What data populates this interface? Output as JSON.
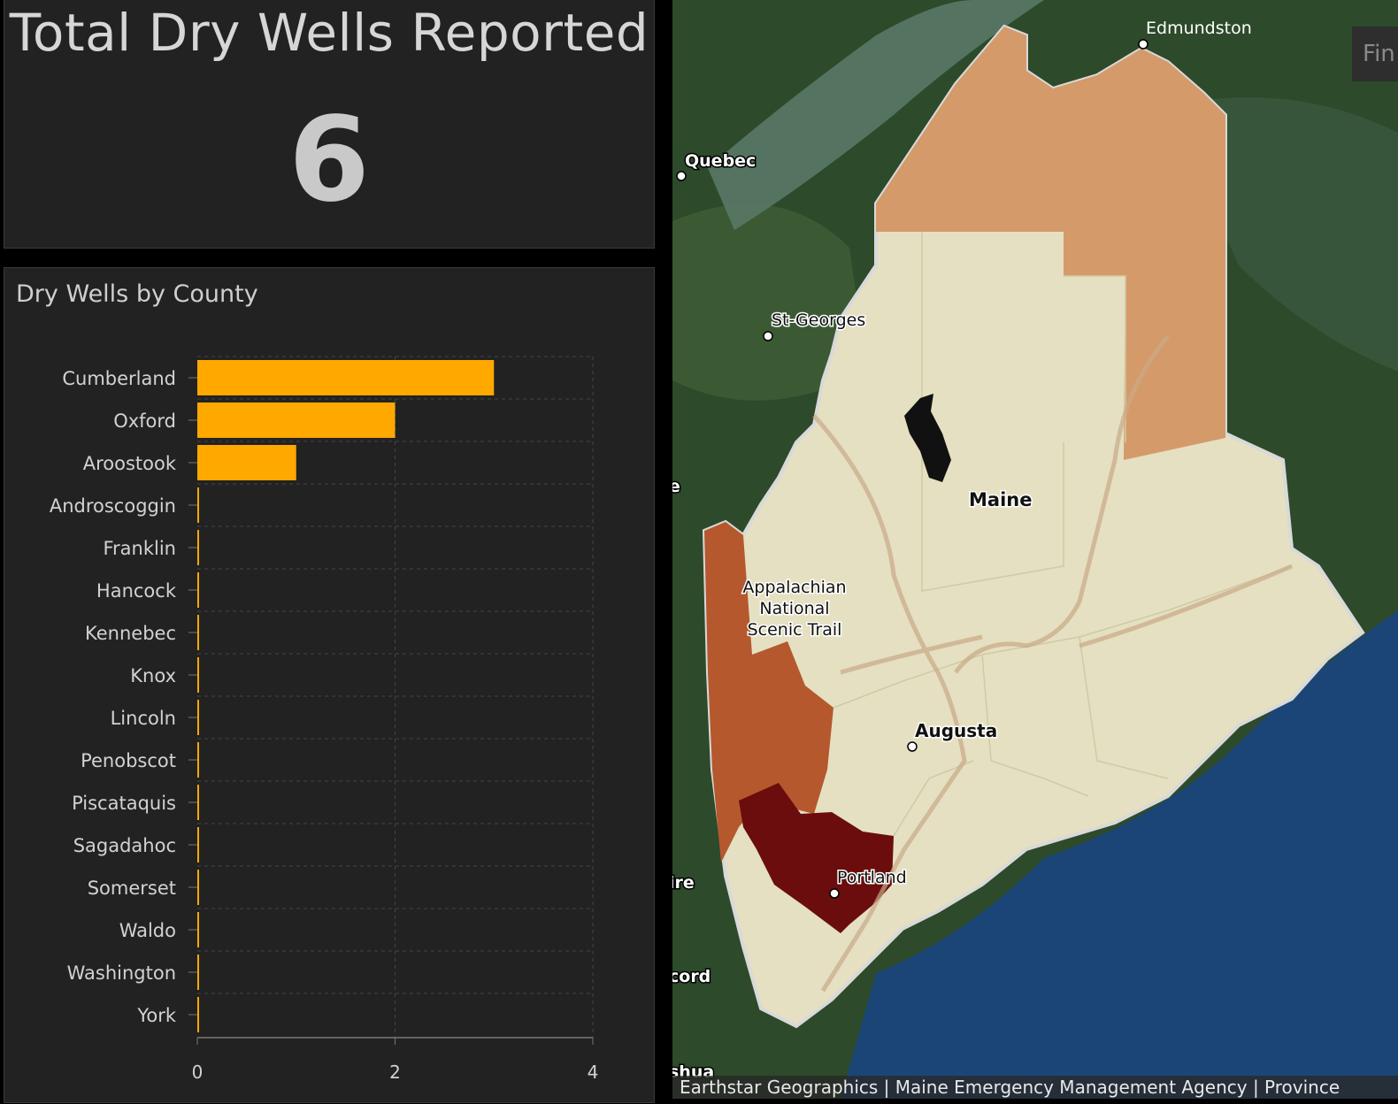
{
  "total": {
    "title": "Total Dry Wells Reported",
    "value": "6"
  },
  "chart_panel": {
    "title": "Dry Wells by County"
  },
  "chart_data": {
    "type": "bar",
    "orientation": "horizontal",
    "title": "Dry Wells by County",
    "categories": [
      "Cumberland",
      "Oxford",
      "Aroostook",
      "Androscoggin",
      "Franklin",
      "Hancock",
      "Kennebec",
      "Knox",
      "Lincoln",
      "Penobscot",
      "Piscataquis",
      "Sagadahoc",
      "Somerset",
      "Waldo",
      "Washington",
      "York"
    ],
    "values": [
      3,
      2,
      1,
      0,
      0,
      0,
      0,
      0,
      0,
      0,
      0,
      0,
      0,
      0,
      0,
      0
    ],
    "xlim": [
      0,
      4
    ],
    "xticks": [
      "0",
      "2",
      "4"
    ],
    "bar_color": "#FFA800",
    "grid": true
  },
  "map": {
    "labels": {
      "edmundston": "Edmundston",
      "quebec": "Quebec",
      "st_georges": "St-Georges",
      "maine": "Maine",
      "trail_line1": "Appalachian",
      "trail_line2": "National",
      "trail_line3": "Scenic Trail",
      "augusta": "Augusta",
      "portland": "Portland",
      "edge_e": "e",
      "edge_ire": "ire",
      "edge_cord": "cord",
      "edge_shua": "shua"
    },
    "find_button_label": "Fin",
    "attribution": "Earthstar Geographics | Maine Emergency Management Agency | Province",
    "colors": {
      "land": "#2d4a2a",
      "water": "#1b4577",
      "maine_fill": "#e4e0c1",
      "aroostook_fill": "#d59a6a",
      "oxford_fill": "#b5582e",
      "cumberland_fill": "#6b0d0d"
    }
  }
}
